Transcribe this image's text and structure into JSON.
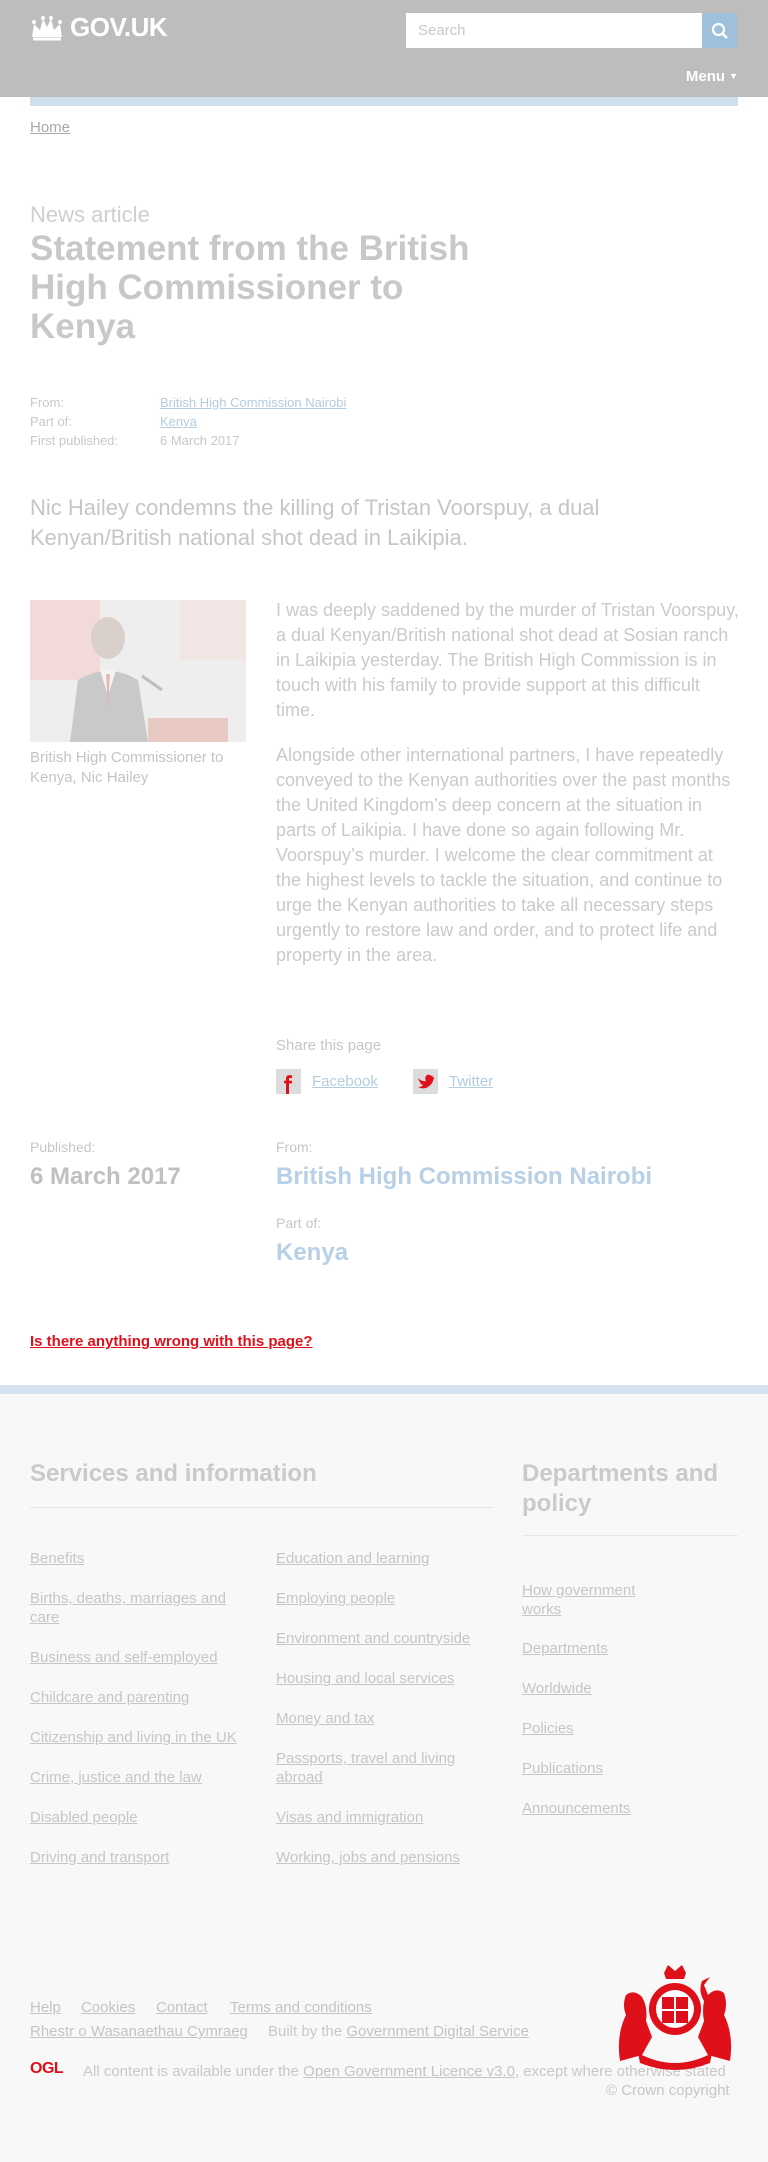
{
  "header": {
    "logo_text": "GOV.UK",
    "search_placeholder": "Search",
    "menu_label": "Menu"
  },
  "breadcrumb": {
    "home": "Home"
  },
  "article": {
    "kicker": "News article",
    "title": "Statement from the British High Commissioner to Kenya",
    "meta": {
      "from_key": "From:",
      "from_val": "British High Commission Nairobi",
      "part_key": "Part of:",
      "part_val": "Kenya",
      "first_key": "First published:",
      "first_val": "6 March 2017"
    },
    "lede": "Nic Hailey condemns the killing of Tristan Voorspuy, a dual Kenyan/British national shot dead in Laikipia.",
    "image_caption": "British High Commissioner to Kenya, Nic Hailey",
    "paragraphs": [
      "I was deeply saddened by the murder of Tristan Voorspuy, a dual Kenyan/British national shot dead at Sosian ranch in Laikipia yesterday. The British High Commission is in touch with his family to provide support at this difficult time.",
      "Alongside other international partners, I have repeatedly conveyed to the Kenyan authorities over the past months the United Kingdom’s deep concern at the situation in parts of Laikipia. I have done so again following Mr. Voorspuy’s murder. I welcome the clear commitment at the highest levels to tackle the situation, and continue to urge the Kenyan authorities to take all necessary steps urgently to restore law and order, and to protect life and property in the area."
    ],
    "share_label": "Share this page",
    "share_facebook": "Facebook",
    "share_twitter": "Twitter",
    "published_label": "Published:",
    "published_date": "6 March 2017",
    "from_label": "From:",
    "from_org": "British High Commission Nairobi",
    "partof_label": "Part of:",
    "partof_topic": "Kenya",
    "report_link": "Is there anything wrong with this page?"
  },
  "footer": {
    "services_heading": "Services and information",
    "services_col1": [
      "Benefits",
      "Births, deaths, marriages and care",
      "Business and self-employed",
      "Childcare and parenting",
      "Citizenship and living in the UK",
      "Crime, justice and the law",
      "Disabled people",
      "Driving and transport"
    ],
    "services_col2": [
      "Education and learning",
      "Employing people",
      "Environment and countryside",
      "Housing and local services",
      "Money and tax",
      "Passports, travel and living abroad",
      "Visas and immigration",
      "Working, jobs and pensions"
    ],
    "departments_heading": "Departments and policy",
    "departments": [
      "How government works",
      "Departments",
      "Worldwide",
      "Policies",
      "Publications",
      "Announcements"
    ],
    "meta_links": [
      "Help",
      "Cookies",
      "Contact",
      "Terms and conditions"
    ],
    "welsh_link": "Rhestr o Wasanaethau Cymraeg",
    "built_by_prefix": "Built by the",
    "built_by_link": "Government Digital Service",
    "ogl": "OGL",
    "licence_prefix": "All content is available under the",
    "licence_link": "Open Government Licence v3.0",
    "licence_suffix": ", except where otherwise stated",
    "copyright": "© Crown copyright"
  },
  "colors": {
    "header_bg": "#bdbdbd",
    "accent_blue": "#cfdfec",
    "report_red": "#e0101a"
  }
}
